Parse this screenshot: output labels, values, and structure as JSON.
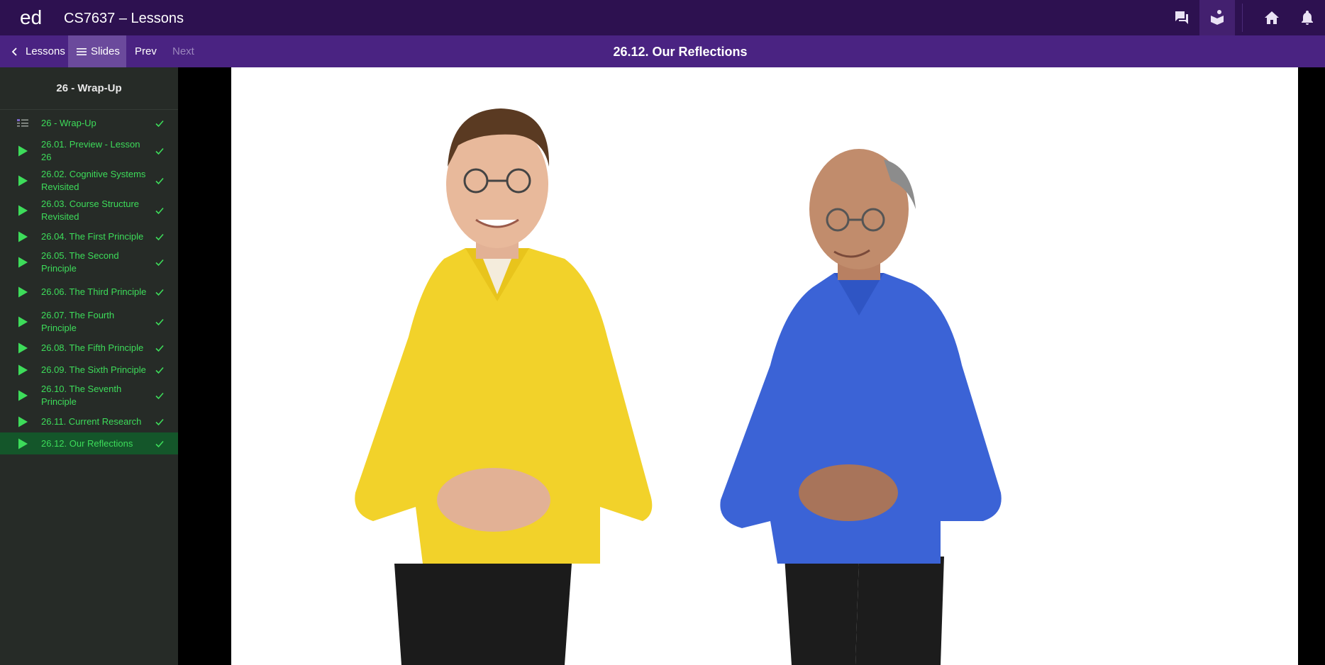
{
  "app": {
    "logo": "ed",
    "course_title": "CS7637 – Lessons"
  },
  "top_icons": [
    "discussion-icon",
    "lessons-icon",
    "home-icon",
    "notifications-icon"
  ],
  "nav": {
    "lessons_label": "Lessons",
    "slides_label": "Slides",
    "prev_label": "Prev",
    "next_label": "Next",
    "current_slide_title": "26.12. Our Reflections"
  },
  "sidebar": {
    "heading": "26 - Wrap-Up",
    "items": [
      {
        "label": "26 - Wrap-Up",
        "icon": "overview-icon",
        "completed": true,
        "active": false
      },
      {
        "label": "26.01. Preview - Lesson 26",
        "icon": "play-icon",
        "completed": true,
        "active": false
      },
      {
        "label": "26.02. Cognitive Systems Revisited",
        "icon": "play-icon",
        "completed": true,
        "active": false
      },
      {
        "label": "26.03. Course Structure Revisited",
        "icon": "play-icon",
        "completed": true,
        "active": false
      },
      {
        "label": "26.04. The First Principle",
        "icon": "play-icon",
        "completed": true,
        "active": false
      },
      {
        "label": "26.05. The Second Principle",
        "icon": "play-icon",
        "completed": true,
        "active": false
      },
      {
        "label": "26.06. The Third Principle",
        "icon": "play-icon",
        "completed": true,
        "active": false
      },
      {
        "label": "26.07. The Fourth Principle",
        "icon": "play-icon",
        "completed": true,
        "active": false
      },
      {
        "label": "26.08. The Fifth Principle",
        "icon": "play-icon",
        "completed": true,
        "active": false
      },
      {
        "label": "26.09. The Sixth Principle",
        "icon": "play-icon",
        "completed": true,
        "active": false
      },
      {
        "label": "26.10. The Seventh Principle",
        "icon": "play-icon",
        "completed": true,
        "active": false
      },
      {
        "label": "26.11. Current Research",
        "icon": "play-icon",
        "completed": true,
        "active": false
      },
      {
        "label": "26.12. Our Reflections",
        "icon": "play-icon",
        "completed": true,
        "active": true
      }
    ]
  },
  "colors": {
    "topbar": "#2d1150",
    "subbar": "#4a2382",
    "sidebar": "#262b27",
    "lesson_green": "#3ddc5a",
    "active_row": "#14562a",
    "shirt_yellow": "#f2d22a",
    "shirt_blue": "#3b63d6"
  }
}
